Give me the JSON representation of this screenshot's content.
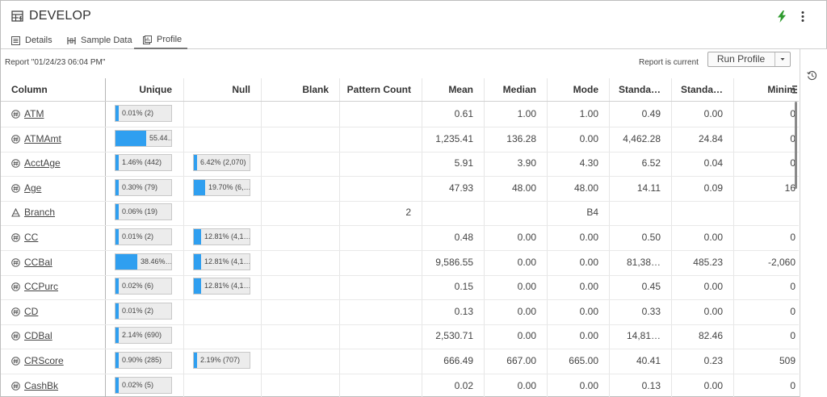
{
  "app": {
    "title": "DEVELOP"
  },
  "tabs": [
    {
      "label": "Details",
      "icon": "details-icon"
    },
    {
      "label": "Sample Data",
      "icon": "sample-data-icon"
    },
    {
      "label": "Profile",
      "icon": "profile-icon",
      "active": true
    }
  ],
  "toolbar": {
    "report_label": "Report \"01/24/23 06:04 PM\"",
    "status": "Report is current",
    "run_button": "Run Profile"
  },
  "colors": {
    "bar_fill": "#2f9ff0",
    "bar_bg": "#ececec",
    "bolt": "#2e9b2e"
  },
  "table": {
    "headers": {
      "column": "Column",
      "unique": "Unique",
      "null": "Null",
      "blank": "Blank",
      "pattern_count": "Pattern Count",
      "mean": "Mean",
      "median": "Median",
      "mode": "Mode",
      "std1": "Standa…",
      "std2": "Standa…",
      "min": "Minim"
    },
    "rows": [
      {
        "name": "ATM",
        "type": "numeric",
        "unique": "0.01% (2)",
        "unique_pct": 0.01,
        "null": "",
        "null_pct": null,
        "blank": "",
        "pattern": "",
        "mean": "0.61",
        "median": "1.00",
        "mode": "1.00",
        "std1": "0.49",
        "std2": "0.00",
        "min": "0"
      },
      {
        "name": "ATMAmt",
        "type": "numeric",
        "unique": "55.44…",
        "unique_pct": 55.44,
        "null": "",
        "null_pct": null,
        "blank": "",
        "pattern": "",
        "mean": "1,235.41",
        "median": "136.28",
        "mode": "0.00",
        "std1": "4,462.28",
        "std2": "24.84",
        "min": "0"
      },
      {
        "name": "AcctAge",
        "type": "numeric",
        "unique": "1.46% (442)",
        "unique_pct": 1.46,
        "null": "6.42% (2,070)",
        "null_pct": 6.42,
        "blank": "",
        "pattern": "",
        "mean": "5.91",
        "median": "3.90",
        "mode": "4.30",
        "std1": "6.52",
        "std2": "0.04",
        "min": "0"
      },
      {
        "name": "Age",
        "type": "numeric",
        "unique": "0.30% (79)",
        "unique_pct": 0.3,
        "null": "19.70% (6,…",
        "null_pct": 19.7,
        "blank": "",
        "pattern": "",
        "mean": "47.93",
        "median": "48.00",
        "mode": "48.00",
        "std1": "14.11",
        "std2": "0.09",
        "min": "16"
      },
      {
        "name": "Branch",
        "type": "character",
        "unique": "0.06% (19)",
        "unique_pct": 0.06,
        "null": "",
        "null_pct": null,
        "blank": "",
        "pattern": "2",
        "mean": "",
        "median": "",
        "mode": "B4",
        "std1": "",
        "std2": "",
        "min": ""
      },
      {
        "name": "CC",
        "type": "numeric",
        "unique": "0.01% (2)",
        "unique_pct": 0.01,
        "null": "12.81% (4,1…",
        "null_pct": 12.81,
        "blank": "",
        "pattern": "",
        "mean": "0.48",
        "median": "0.00",
        "mode": "0.00",
        "std1": "0.50",
        "std2": "0.00",
        "min": "0"
      },
      {
        "name": "CCBal",
        "type": "numeric",
        "unique": "38.46%…",
        "unique_pct": 38.46,
        "null": "12.81% (4,1…",
        "null_pct": 12.81,
        "blank": "",
        "pattern": "",
        "mean": "9,586.55",
        "median": "0.00",
        "mode": "0.00",
        "std1": "81,38…",
        "std2": "485.23",
        "min": "-2,060"
      },
      {
        "name": "CCPurc",
        "type": "numeric",
        "unique": "0.02% (6)",
        "unique_pct": 0.02,
        "null": "12.81% (4,1…",
        "null_pct": 12.81,
        "blank": "",
        "pattern": "",
        "mean": "0.15",
        "median": "0.00",
        "mode": "0.00",
        "std1": "0.45",
        "std2": "0.00",
        "min": "0"
      },
      {
        "name": "CD",
        "type": "numeric",
        "unique": "0.01% (2)",
        "unique_pct": 0.01,
        "null": "",
        "null_pct": null,
        "blank": "",
        "pattern": "",
        "mean": "0.13",
        "median": "0.00",
        "mode": "0.00",
        "std1": "0.33",
        "std2": "0.00",
        "min": "0"
      },
      {
        "name": "CDBal",
        "type": "numeric",
        "unique": "2.14% (690)",
        "unique_pct": 2.14,
        "null": "",
        "null_pct": null,
        "blank": "",
        "pattern": "",
        "mean": "2,530.71",
        "median": "0.00",
        "mode": "0.00",
        "std1": "14,81…",
        "std2": "82.46",
        "min": "0"
      },
      {
        "name": "CRScore",
        "type": "numeric",
        "unique": "0.90% (285)",
        "unique_pct": 0.9,
        "null": "2.19% (707)",
        "null_pct": 2.19,
        "blank": "",
        "pattern": "",
        "mean": "666.49",
        "median": "667.00",
        "mode": "665.00",
        "std1": "40.41",
        "std2": "0.23",
        "min": "509"
      },
      {
        "name": "CashBk",
        "type": "numeric",
        "unique": "0.02% (5)",
        "unique_pct": 0.02,
        "null": "",
        "null_pct": null,
        "blank": "",
        "pattern": "",
        "mean": "0.02",
        "median": "0.00",
        "mode": "0.00",
        "std1": "0.13",
        "std2": "0.00",
        "min": "0"
      }
    ]
  }
}
